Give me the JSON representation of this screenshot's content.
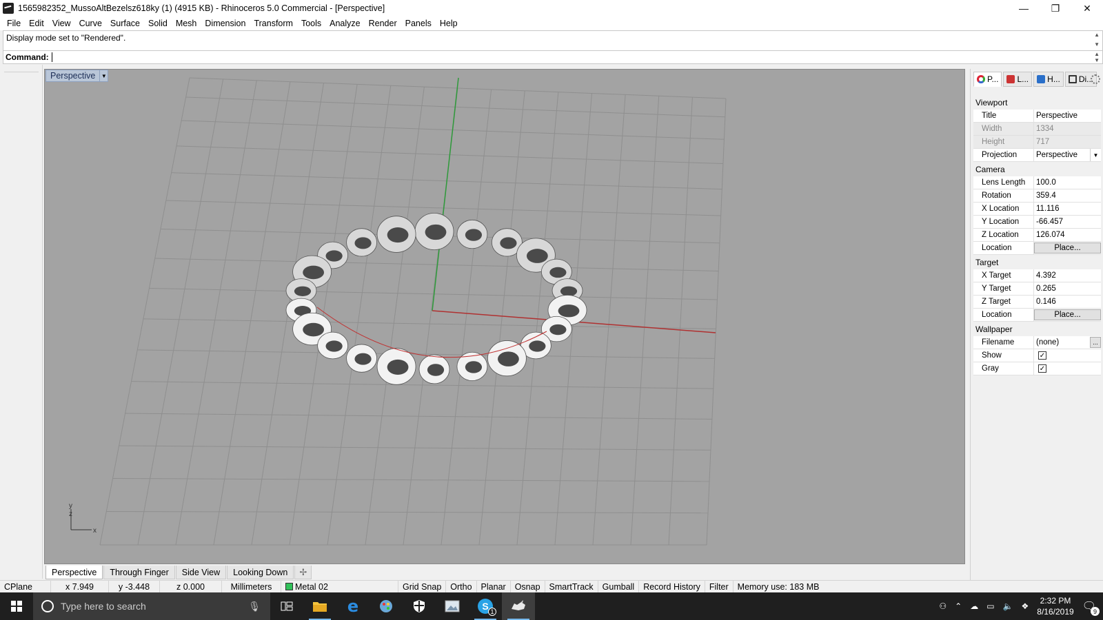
{
  "window": {
    "title": "1565982352_MussoAltBezelsz618ky (1) (4915 KB) - Rhinoceros 5.0 Commercial - [Perspective]",
    "controls": [
      "—",
      "❐",
      "✕"
    ]
  },
  "menu": [
    "File",
    "Edit",
    "View",
    "Curve",
    "Surface",
    "Solid",
    "Mesh",
    "Dimension",
    "Transform",
    "Tools",
    "Analyze",
    "Render",
    "Panels",
    "Help"
  ],
  "command": {
    "history": "Display mode set to \"Rendered\".",
    "prompt_label": "Command:"
  },
  "viewport": {
    "label": "Perspective",
    "axis_x": "x",
    "axis_y": "y",
    "axis_z": "z"
  },
  "viewport_tabs": [
    "Perspective",
    "Through Finger",
    "Side View",
    "Looking Down"
  ],
  "panel": {
    "tabs": [
      "P...",
      "L...",
      "H...",
      "Di..."
    ],
    "sections": {
      "viewport": {
        "heading": "Viewport",
        "title_k": "Title",
        "title_v": "Perspective",
        "width_k": "Width",
        "width_v": "1334",
        "height_k": "Height",
        "height_v": "717",
        "projection_k": "Projection",
        "projection_v": "Perspective"
      },
      "camera": {
        "heading": "Camera",
        "lens_k": "Lens Length",
        "lens_v": "100.0",
        "rotation_k": "Rotation",
        "rotation_v": "359.4",
        "xloc_k": "X Location",
        "xloc_v": "11.116",
        "yloc_k": "Y Location",
        "yloc_v": "-66.457",
        "zloc_k": "Z Location",
        "zloc_v": "126.074",
        "loc_k": "Location",
        "loc_btn": "Place..."
      },
      "target": {
        "heading": "Target",
        "xt_k": "X Target",
        "xt_v": "4.392",
        "yt_k": "Y Target",
        "yt_v": "0.265",
        "zt_k": "Z Target",
        "zt_v": "0.146",
        "loc_k": "Location",
        "loc_btn": "Place..."
      },
      "wallpaper": {
        "heading": "Wallpaper",
        "file_k": "Filename",
        "file_v": "(none)",
        "file_btn": "...",
        "show_k": "Show",
        "gray_k": "Gray"
      }
    }
  },
  "status": {
    "cplane": "CPlane",
    "x": "x 7.949",
    "y": "y -3.448",
    "z": "z 0.000",
    "units": "Millimeters",
    "layer": "Metal 02",
    "grid_snap": "Grid Snap",
    "ortho": "Ortho",
    "planar": "Planar",
    "osnap": "Osnap",
    "smarttrack": "SmartTrack",
    "gumball": "Gumball",
    "record_history": "Record History",
    "filter": "Filter",
    "memory": "Memory use: 183 MB"
  },
  "taskbar": {
    "search_placeholder": "Type here to search",
    "time": "2:32 PM",
    "date": "8/16/2019",
    "notification_count": "9",
    "skype_badge": "1"
  },
  "colors": {
    "viewport_bg": "#a3a3a3",
    "grid_line": "#8f8f8f",
    "x_axis": "#b03030",
    "y_axis": "#2e9a3a",
    "layer_swatch": "#31c25a"
  }
}
